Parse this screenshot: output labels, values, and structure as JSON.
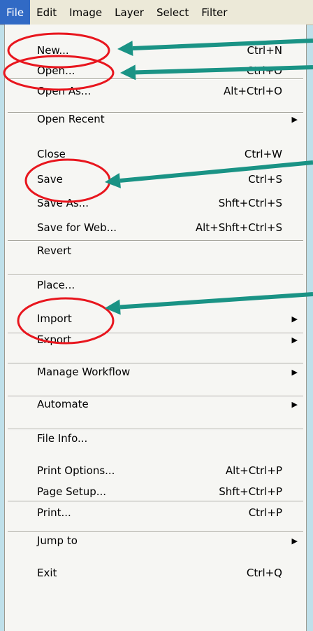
{
  "menubar": [
    "File",
    "Edit",
    "Image",
    "Layer",
    "Select",
    "Filter"
  ],
  "items": [
    {
      "label": "New...",
      "shortcut": "Ctrl+N",
      "sub": false
    },
    {
      "label": "Open...",
      "shortcut": "Ctrl+O",
      "sub": false
    },
    {
      "label": "Open As...",
      "shortcut": "Alt+Ctrl+O",
      "sub": false
    },
    {
      "label": "Open Recent",
      "shortcut": "",
      "sub": true
    },
    {
      "label": "Close",
      "shortcut": "Ctrl+W",
      "sub": false
    },
    {
      "label": "Save",
      "shortcut": "Ctrl+S",
      "sub": false
    },
    {
      "label": "Save As...",
      "shortcut": "Shft+Ctrl+S",
      "sub": false
    },
    {
      "label": "Save for Web...",
      "shortcut": "Alt+Shft+Ctrl+S",
      "sub": false
    },
    {
      "label": "Revert",
      "shortcut": "",
      "sub": false
    },
    {
      "label": "Place...",
      "shortcut": "",
      "sub": false
    },
    {
      "label": "Import",
      "shortcut": "",
      "sub": true
    },
    {
      "label": "Export",
      "shortcut": "",
      "sub": true
    },
    {
      "label": "Manage Workflow",
      "shortcut": "",
      "sub": true
    },
    {
      "label": "Automate",
      "shortcut": "",
      "sub": true
    },
    {
      "label": "File Info...",
      "shortcut": "",
      "sub": false
    },
    {
      "label": "Print Options...",
      "shortcut": "Alt+Ctrl+P",
      "sub": false
    },
    {
      "label": "Page Setup...",
      "shortcut": "Shft+Ctrl+P",
      "sub": false
    },
    {
      "label": "Print...",
      "shortcut": "Ctrl+P",
      "sub": false
    },
    {
      "label": "Jump to",
      "shortcut": "",
      "sub": true
    },
    {
      "label": "Exit",
      "shortcut": "Ctrl+Q",
      "sub": false
    }
  ],
  "colors": {
    "highlight": "#316ac5",
    "annotation_ellipse": "#e8161e",
    "annotation_arrow": "#1a9385",
    "background": "#bfe0ea"
  }
}
